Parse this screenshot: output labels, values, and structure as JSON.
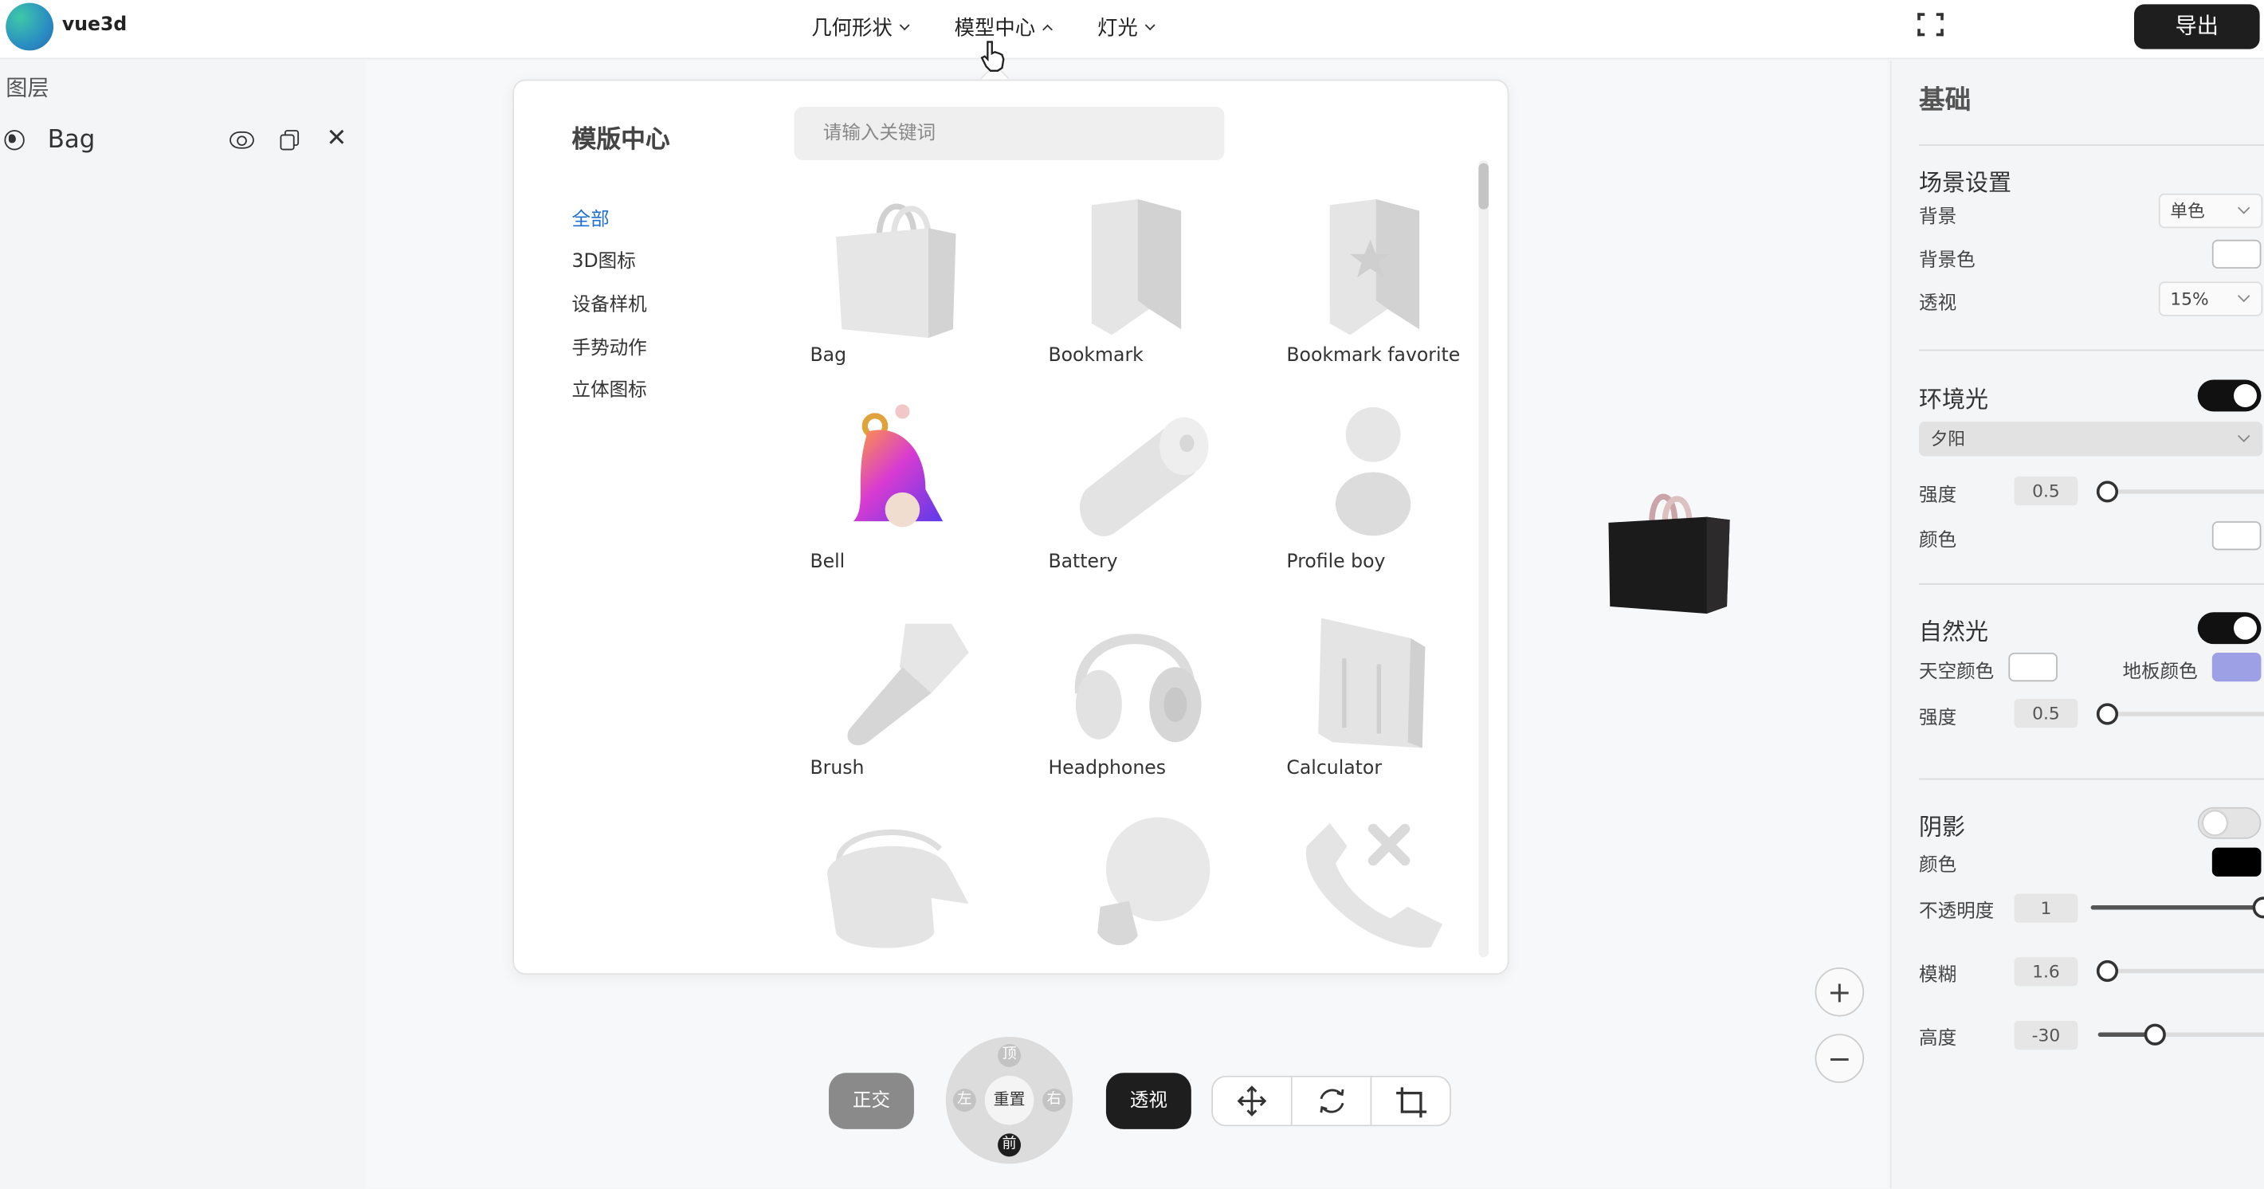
{
  "app": {
    "name": "vue3d",
    "export_label": "导出"
  },
  "menus": [
    {
      "label": "几何形状",
      "state": "collapsed"
    },
    {
      "label": "模型中心",
      "state": "expanded"
    },
    {
      "label": "灯光",
      "state": "collapsed"
    }
  ],
  "layers": {
    "title": "图层",
    "items": [
      {
        "name": "Bag",
        "icon": "globe-icon"
      }
    ]
  },
  "template_center": {
    "title": "模版中心",
    "search_placeholder": "请输入关键词",
    "categories": [
      "全部",
      "3D图标",
      "设备样机",
      "手势动作",
      "立体图标"
    ],
    "active_category": "全部",
    "models": [
      "Bag",
      "Bookmark",
      "Bookmark favorite",
      "Bell",
      "Battery",
      "Profile boy",
      "Brush",
      "Headphones",
      "Calculator"
    ],
    "partially_visible_models": [
      "bucket",
      "light-bulb",
      "phone-call"
    ]
  },
  "view_controls": {
    "ortho": "正交",
    "perspective": "透视",
    "top": "顶",
    "left": "左",
    "reset": "重置",
    "right": "右",
    "front": "前"
  },
  "zoom": {
    "in": "+",
    "out": "−"
  },
  "properties": {
    "section_title": "基础",
    "scene": {
      "title": "场景设置",
      "background_label": "背景",
      "background_value": "单色",
      "bg_color_label": "背景色",
      "bg_color": "#ffffff",
      "perspective_label": "透视",
      "perspective_value": "15%"
    },
    "ambient": {
      "title": "环境光",
      "enabled": true,
      "preset": "夕阳",
      "intensity_label": "强度",
      "intensity": "0.5",
      "intensity_level": 0.05,
      "color_label": "颜色",
      "color": "#ffffff"
    },
    "hemisphere": {
      "title": "自然光",
      "enabled": true,
      "sky_label": "天空颜色",
      "sky_color": "#ffffff",
      "ground_label": "地板颜色",
      "ground_color": "#9ea0e6",
      "intensity_label": "强度",
      "intensity": "0.5",
      "intensity_level": 0.05
    },
    "shadow": {
      "title": "阴影",
      "enabled": false,
      "color_label": "颜色",
      "color": "#000000",
      "opacity_label": "不透明度",
      "opacity": "1",
      "opacity_level": 1.0,
      "blur_label": "模糊",
      "blur": "1.6",
      "blur_level": 0.05,
      "height_label": "高度",
      "height": "-30",
      "height_level": 0.33
    }
  }
}
